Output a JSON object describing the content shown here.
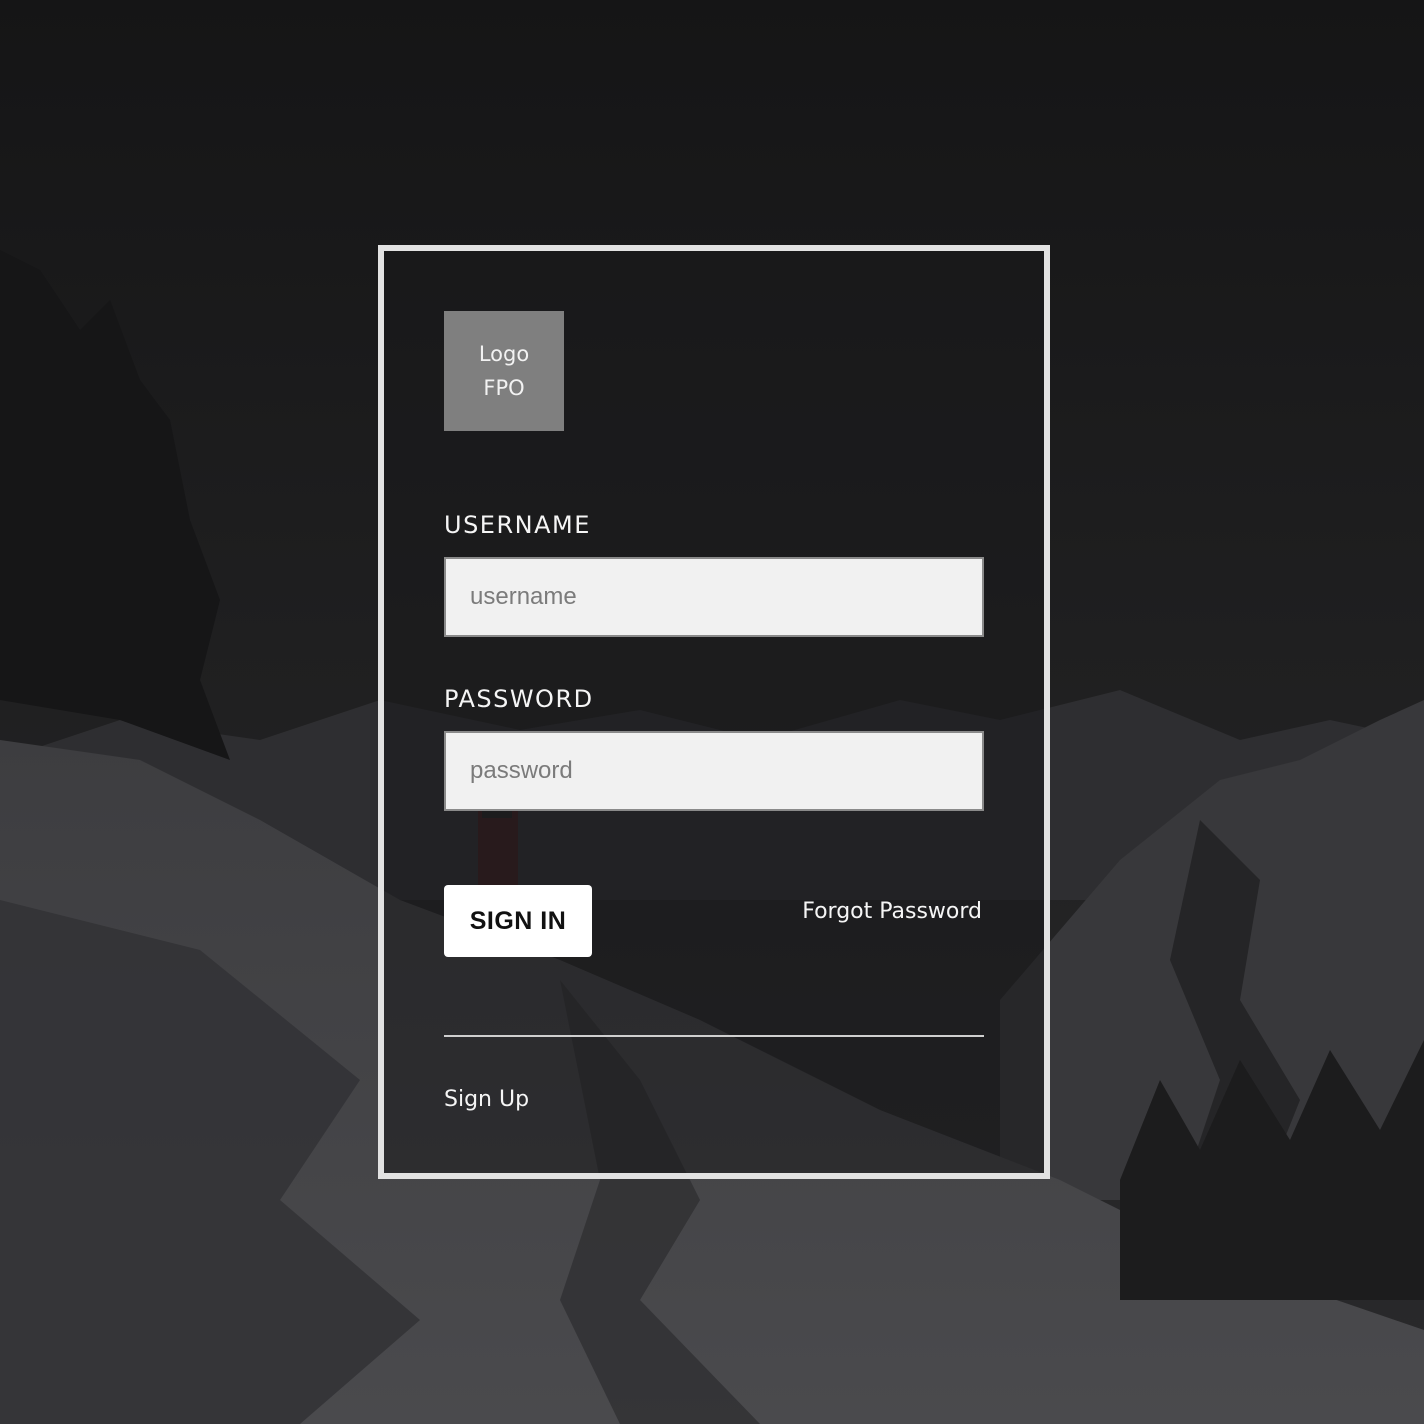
{
  "logo": {
    "line1": "Logo",
    "line2": "FPO"
  },
  "form": {
    "username_label": "USERNAME",
    "username_placeholder": "username",
    "username_value": "",
    "password_label": "PASSWORD",
    "password_placeholder": "password",
    "password_value": "",
    "signin_label": "SIGN IN",
    "forgot_label": "Forgot Password",
    "signup_label": "Sign Up"
  },
  "colors": {
    "card_border": "#e2e2e2",
    "input_background": "#f1f1f1",
    "button_background": "#ffffff",
    "logo_background": "#7f7f7f"
  }
}
